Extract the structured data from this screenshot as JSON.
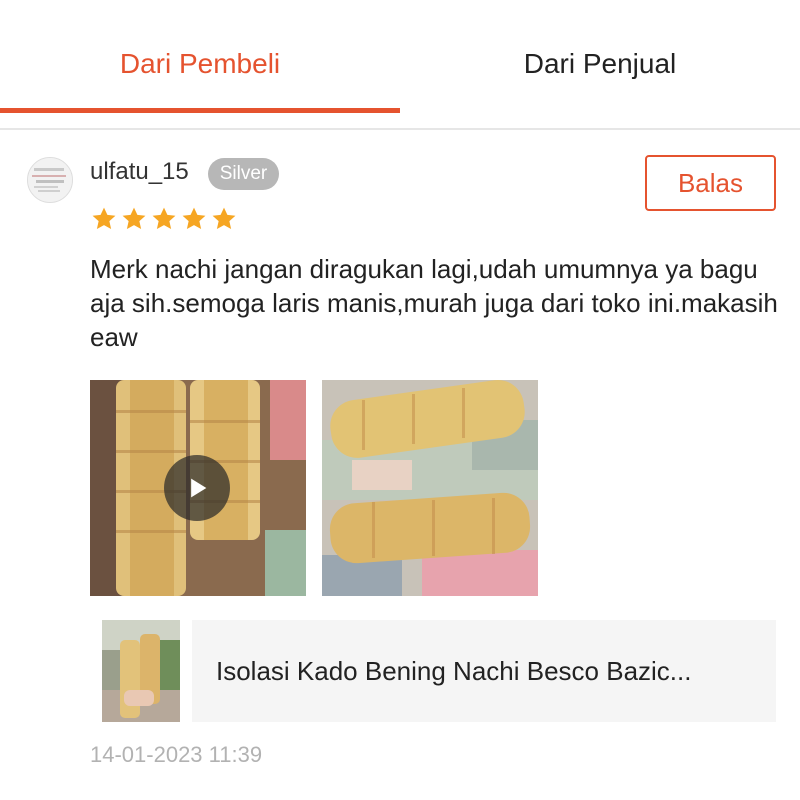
{
  "tabs": [
    {
      "label": "Dari Pembeli",
      "active": true
    },
    {
      "label": "Dari Penjual",
      "active": false
    }
  ],
  "review": {
    "username": "ulfatu_15",
    "badge": "Silver",
    "rating": 5,
    "reply_label": "Balas",
    "text": "Merk nachi  jangan diragukan lagi,udah umumnya ya bagu aja sih.semoga laris manis,murah juga dari toko ini.makasih eaw",
    "media": [
      {
        "type": "video",
        "icon": "play-icon"
      },
      {
        "type": "photo"
      }
    ],
    "product_name": "Isolasi Kado Bening Nachi Besco Bazic...",
    "timestamp": "14-01-2023 11:39"
  },
  "colors": {
    "accent": "#e5532f",
    "star": "#f6a623",
    "badge_bg": "#b7b7b7",
    "muted_text": "#b2b2b2",
    "product_bg": "#f5f5f5"
  }
}
